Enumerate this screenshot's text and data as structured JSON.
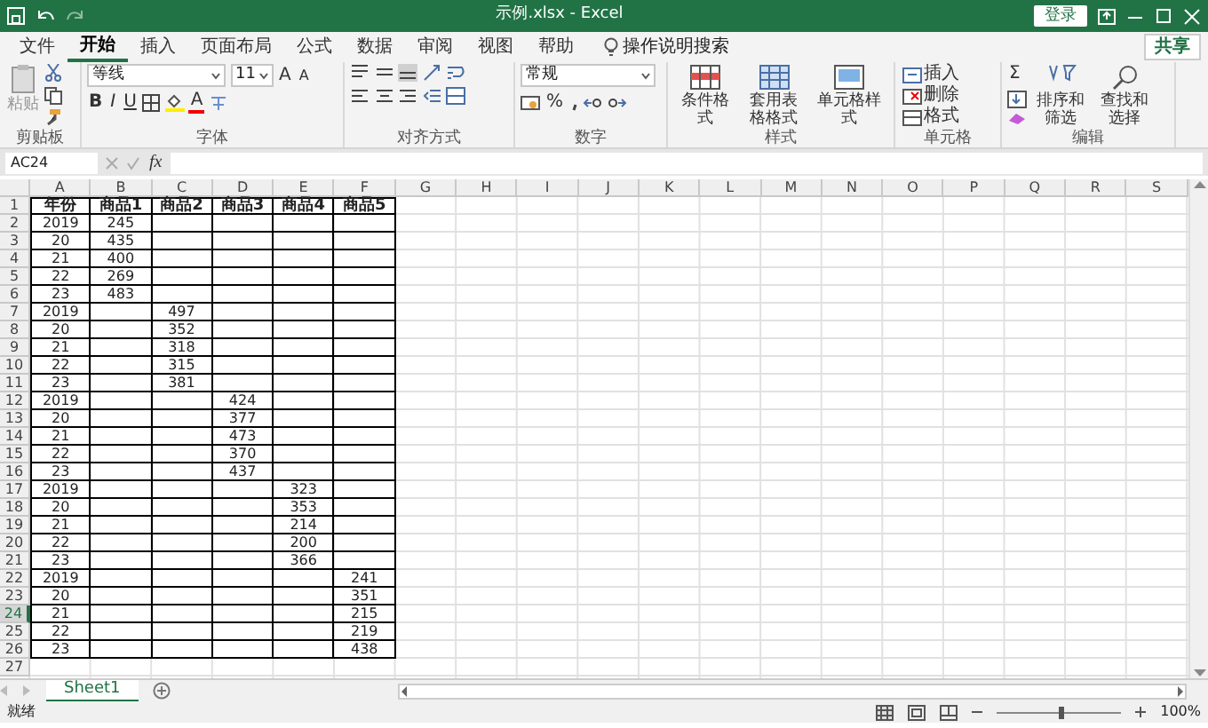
{
  "window": {
    "title": "示例.xlsx - Excel",
    "login": "登录",
    "share": "共享"
  },
  "menu_tabs": [
    {
      "label": "文件",
      "selected": false
    },
    {
      "label": "开始",
      "selected": true
    },
    {
      "label": "插入",
      "selected": false
    },
    {
      "label": "页面布局",
      "selected": false
    },
    {
      "label": "公式",
      "selected": false
    },
    {
      "label": "数据",
      "selected": false
    },
    {
      "label": "审阅",
      "selected": false
    },
    {
      "label": "视图",
      "selected": false
    },
    {
      "label": "帮助",
      "selected": false
    }
  ],
  "tell_me": "操作说明搜索",
  "ribbon": {
    "clipboard": {
      "paste": "粘贴",
      "label": "剪贴板"
    },
    "font": {
      "name": "等线",
      "size": "11",
      "grow": "A",
      "shrink": "A",
      "bold": "B",
      "italic": "I",
      "underline": "U",
      "font_color": "A",
      "label": "字体"
    },
    "alignment": {
      "label": "对齐方式"
    },
    "number": {
      "format": "常规",
      "percent": "%",
      "label": "数字"
    },
    "styles": {
      "buttons": [
        "条件格式",
        "套用表格格式",
        "单元格样式"
      ],
      "label": "样式"
    },
    "cells": {
      "buttons": [
        "插入",
        "删除",
        "格式"
      ],
      "label": "单元格"
    },
    "editing": {
      "sum": "Σ",
      "buttons": [
        "排序和筛选",
        "查找和选择"
      ],
      "label": "编辑"
    }
  },
  "formula_bar": {
    "name_box": "AC24",
    "fx": "fx"
  },
  "sheet": {
    "columns": [
      "A",
      "B",
      "C",
      "D",
      "E",
      "F",
      "G",
      "H",
      "I",
      "J",
      "K",
      "L",
      "M",
      "N",
      "O",
      "P",
      "Q",
      "R",
      "S"
    ],
    "rows": [
      {
        "header": "1",
        "selected": false,
        "bold": true,
        "bordered": true,
        "cells": {
          "A": "年份",
          "B": "商品1",
          "C": "商品2",
          "D": "商品3",
          "E": "商品4",
          "F": "商品5"
        }
      },
      {
        "header": "2",
        "selected": false,
        "bold": false,
        "bordered": true,
        "cells": {
          "A": "2019",
          "B": "245"
        }
      },
      {
        "header": "3",
        "selected": false,
        "bold": false,
        "bordered": true,
        "cells": {
          "A": "20",
          "B": "435"
        }
      },
      {
        "header": "4",
        "selected": false,
        "bold": false,
        "bordered": true,
        "cells": {
          "A": "21",
          "B": "400"
        }
      },
      {
        "header": "5",
        "selected": false,
        "bold": false,
        "bordered": true,
        "cells": {
          "A": "22",
          "B": "269"
        }
      },
      {
        "header": "6",
        "selected": false,
        "bold": false,
        "bordered": true,
        "cells": {
          "A": "23",
          "B": "483"
        }
      },
      {
        "header": "7",
        "selected": false,
        "bold": false,
        "bordered": true,
        "cells": {
          "A": "2019",
          "C": "497"
        }
      },
      {
        "header": "8",
        "selected": false,
        "bold": false,
        "bordered": true,
        "cells": {
          "A": "20",
          "C": "352"
        }
      },
      {
        "header": "9",
        "selected": false,
        "bold": false,
        "bordered": true,
        "cells": {
          "A": "21",
          "C": "318"
        }
      },
      {
        "header": "10",
        "selected": false,
        "bold": false,
        "bordered": true,
        "cells": {
          "A": "22",
          "C": "315"
        }
      },
      {
        "header": "11",
        "selected": false,
        "bold": false,
        "bordered": true,
        "cells": {
          "A": "23",
          "C": "381"
        }
      },
      {
        "header": "12",
        "selected": false,
        "bold": false,
        "bordered": true,
        "cells": {
          "A": "2019",
          "D": "424"
        }
      },
      {
        "header": "13",
        "selected": false,
        "bold": false,
        "bordered": true,
        "cells": {
          "A": "20",
          "D": "377"
        }
      },
      {
        "header": "14",
        "selected": false,
        "bold": false,
        "bordered": true,
        "cells": {
          "A": "21",
          "D": "473"
        }
      },
      {
        "header": "15",
        "selected": false,
        "bold": false,
        "bordered": true,
        "cells": {
          "A": "22",
          "D": "370"
        }
      },
      {
        "header": "16",
        "selected": false,
        "bold": false,
        "bordered": true,
        "cells": {
          "A": "23",
          "D": "437"
        }
      },
      {
        "header": "17",
        "selected": false,
        "bold": false,
        "bordered": true,
        "cells": {
          "A": "2019",
          "E": "323"
        }
      },
      {
        "header": "18",
        "selected": false,
        "bold": false,
        "bordered": true,
        "cells": {
          "A": "20",
          "E": "353"
        }
      },
      {
        "header": "19",
        "selected": false,
        "bold": false,
        "bordered": true,
        "cells": {
          "A": "21",
          "E": "214"
        }
      },
      {
        "header": "20",
        "selected": false,
        "bold": false,
        "bordered": true,
        "cells": {
          "A": "22",
          "E": "200"
        }
      },
      {
        "header": "21",
        "selected": false,
        "bold": false,
        "bordered": true,
        "cells": {
          "A": "23",
          "E": "366"
        }
      },
      {
        "header": "22",
        "selected": false,
        "bold": false,
        "bordered": true,
        "cells": {
          "A": "2019",
          "F": "241"
        }
      },
      {
        "header": "23",
        "selected": false,
        "bold": false,
        "bordered": true,
        "cells": {
          "A": "20",
          "F": "351"
        }
      },
      {
        "header": "24",
        "selected": true,
        "bold": false,
        "bordered": true,
        "cells": {
          "A": "21",
          "F": "215"
        }
      },
      {
        "header": "25",
        "selected": false,
        "bold": false,
        "bordered": true,
        "cells": {
          "A": "22",
          "F": "219"
        }
      },
      {
        "header": "26",
        "selected": false,
        "bold": false,
        "bordered": true,
        "cells": {
          "A": "23",
          "F": "438"
        }
      },
      {
        "header": "27",
        "selected": false,
        "cells": {}
      }
    ]
  },
  "sheet_tabs": [
    {
      "label": "Sheet1",
      "selected": true
    }
  ],
  "status_bar": {
    "mode": "就绪",
    "zoom": {
      "level": 0.5,
      "reading": "100%"
    }
  }
}
